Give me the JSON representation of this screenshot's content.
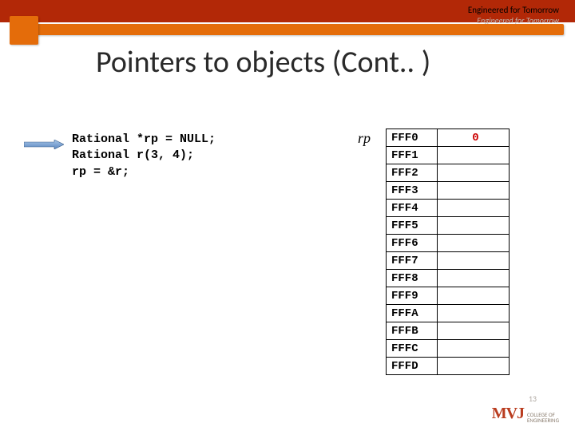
{
  "header": {
    "tagline_top": "Engineered for Tomorrow",
    "tagline_sub": "Engineered for Tomorrow"
  },
  "title": "Pointers to objects (Cont.. )",
  "code": {
    "line1": "Rational *rp = NULL;",
    "line2": "Rational r(3, 4);",
    "line3": "rp = &r;"
  },
  "pointer_label": "rp",
  "memory": {
    "rows": [
      {
        "addr": "FFF0",
        "val": "0"
      },
      {
        "addr": "FFF1",
        "val": ""
      },
      {
        "addr": "FFF2",
        "val": ""
      },
      {
        "addr": "FFF3",
        "val": ""
      },
      {
        "addr": "FFF4",
        "val": ""
      },
      {
        "addr": "FFF5",
        "val": ""
      },
      {
        "addr": "FFF6",
        "val": ""
      },
      {
        "addr": "FFF7",
        "val": ""
      },
      {
        "addr": "FFF8",
        "val": ""
      },
      {
        "addr": "FFF9",
        "val": ""
      },
      {
        "addr": "FFFA",
        "val": ""
      },
      {
        "addr": "FFFB",
        "val": ""
      },
      {
        "addr": "FFFC",
        "val": ""
      },
      {
        "addr": "FFFD",
        "val": ""
      }
    ]
  },
  "footer": {
    "logo_mark": "MVJ",
    "logo_text_1": "COLLEGE OF",
    "logo_text_2": "ENGINEERING",
    "slide_number": "13"
  },
  "colors": {
    "brick": "#b22807",
    "orange": "#e46c0a",
    "zero_red": "#cc0000"
  }
}
